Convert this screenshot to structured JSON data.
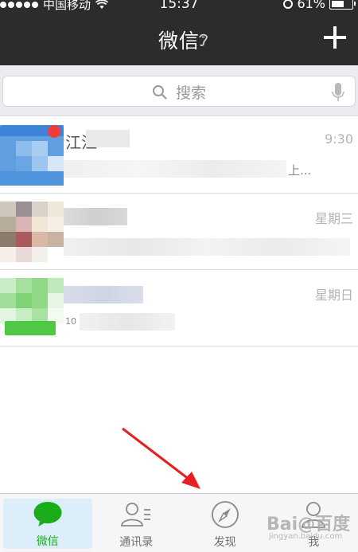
{
  "status_bar": {
    "carrier": "中国移动",
    "time": "15:37",
    "battery": "61%",
    "battery_level": 0.61
  },
  "nav": {
    "title": "微信"
  },
  "search": {
    "placeholder": "搜索"
  },
  "chats": [
    {
      "name": "江江",
      "preview": "上...",
      "time": "9:30",
      "unread": true
    },
    {
      "name": "",
      "preview": "",
      "time": "星期三",
      "unread": false
    },
    {
      "name": "",
      "preview": "10",
      "time": "星期日",
      "unread": false
    }
  ],
  "tabs": [
    {
      "label": "微信",
      "icon": "chat-bubble-icon",
      "active": true
    },
    {
      "label": "通讯录",
      "icon": "contacts-icon",
      "active": false
    },
    {
      "label": "发现",
      "icon": "compass-icon",
      "active": false
    },
    {
      "label": "我",
      "icon": "person-icon",
      "active": false
    }
  ],
  "watermark": {
    "text": "Bai@百度",
    "sub": "jingyan.baidu.com"
  },
  "colors": {
    "header_bg": "#2c2c2c",
    "accent_green": "#1aad19",
    "unread_red": "#f23a3a",
    "annotation_red": "#e62020"
  }
}
